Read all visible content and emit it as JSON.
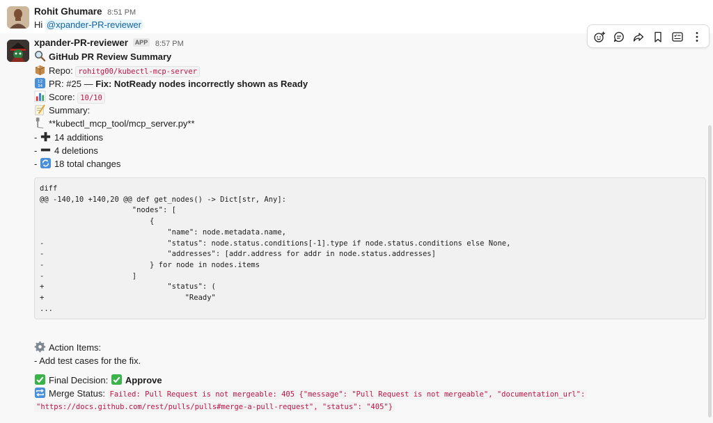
{
  "message1": {
    "author": "Rohit Ghumare",
    "time": "8:51 PM",
    "greeting": "Hi ",
    "mention": "@xpander-PR-reviewer"
  },
  "message2": {
    "author": "xpander-PR-reviewer",
    "badge": "APP",
    "time": "8:57 PM",
    "title": "GitHub PR Review Summary",
    "repo_label": "Repo: ",
    "repo_value": "rohitg00/kubectl-mcp-server",
    "pr_label": "PR: #25 — ",
    "pr_title": "Fix: NotReady nodes incorrectly shown as Ready",
    "score_label": "Score: ",
    "score_value": "10/10",
    "summary_label": "Summary:",
    "file_line": "**kubectl_mcp_tool/mcp_server.py**",
    "additions": "14 additions",
    "deletions": "4 deletions",
    "total_changes": "18 total changes",
    "dash": "- ",
    "code_lines": [
      "diff",
      "@@ -140,10 +140,20 @@ def get_nodes() -> Dict[str, Any]:",
      "                     \"nodes\": [",
      "                         {",
      "                             \"name\": node.metadata.name,",
      "-                            \"status\": node.status.conditions[-1].type if node.status.conditions else None,",
      "-                            \"addresses\": [addr.address for addr in node.status.addresses]",
      "-                        } for node in nodes.items",
      "-                    ]",
      "+                            \"status\": (",
      "+                                \"Ready\"",
      "..."
    ],
    "action_items_label": "Action Items:",
    "action_item_1": "- Add test cases for the fix.",
    "final_decision_label": "Final Decision: ",
    "final_decision_value": "Approve",
    "merge_status_label": "Merge Status: ",
    "merge_status_line1": "Failed: Pull Request is not mergeable: 405 {\"message\": \"Pull Request is not mergeable\", \"documentation_url\":",
    "merge_status_line2": "\"https://docs.github.com/rest/pulls/pulls#merge-a-pull-request\", \"status\": \"405\"}"
  },
  "toolbar": {
    "icons": [
      "add-reaction-icon",
      "reply-in-thread-icon",
      "forward-icon",
      "bookmark-icon",
      "task-list-icon",
      "more-actions-icon"
    ]
  },
  "colors": {
    "mention": "#1264a3",
    "code_red": "#c01343",
    "hover_bg": "#f8f8f8"
  }
}
